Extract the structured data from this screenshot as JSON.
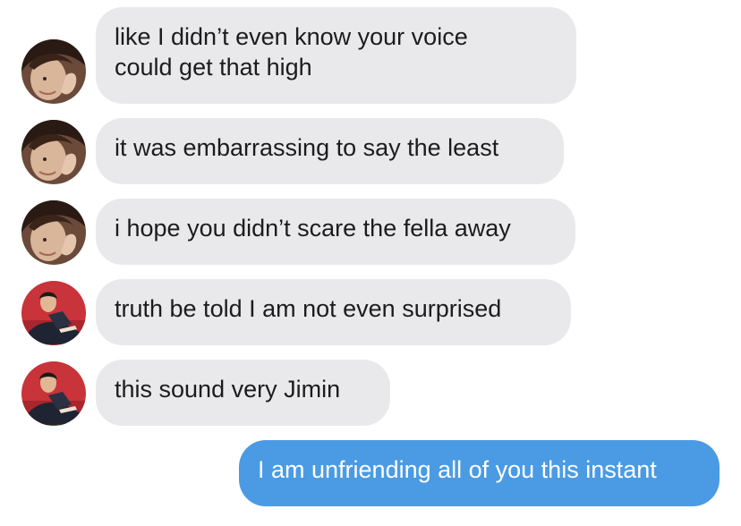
{
  "messages": [
    {
      "sender": "avatar-a",
      "text": "like I didn’t even know your voice\ncould get that high"
    },
    {
      "sender": "avatar-a",
      "text": "it was embarrassing to say the least"
    },
    {
      "sender": "avatar-a",
      "text": "i hope you didn’t scare the fella away"
    },
    {
      "sender": "avatar-b",
      "text": "truth be told I am not even surprised"
    },
    {
      "sender": "avatar-b",
      "text": "this sound very Jimin"
    },
    {
      "sender": "me",
      "text": "I am unfriending all of you this instant"
    }
  ],
  "colors": {
    "received_bubble": "#e9e9eb",
    "sent_bubble": "#4a9be3",
    "received_text": "#1c1c1e",
    "sent_text": "#ffffff"
  }
}
